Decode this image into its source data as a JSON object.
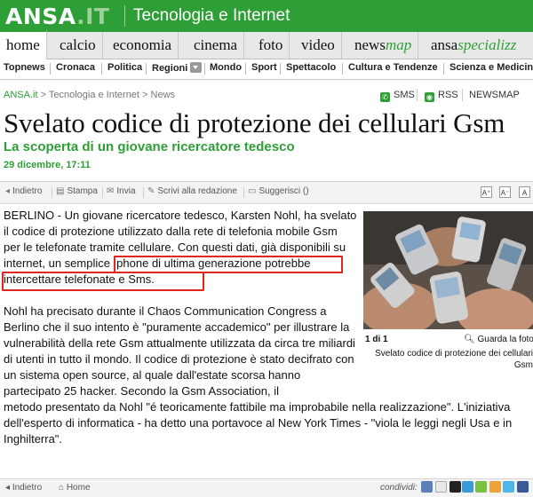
{
  "header": {
    "logo_main": "ANSA",
    "logo_suffix": ".IT",
    "section": "Tecnologia e Internet"
  },
  "main_nav": [
    {
      "label": "home"
    },
    {
      "label": "calcio"
    },
    {
      "label": "economia"
    },
    {
      "label": "cinema"
    },
    {
      "label": "foto"
    },
    {
      "label": "video"
    },
    {
      "label_a": "news",
      "label_b": "map"
    },
    {
      "label_a": "ansa",
      "label_b": "specializz"
    }
  ],
  "sub_nav": [
    "Topnews",
    "Cronaca",
    "Politica",
    "Regioni",
    "Mondo",
    "Sport",
    "Spettacolo",
    "Cultura e Tendenze",
    "Scienza e Medicina"
  ],
  "breadcrumb": {
    "home": "ANSA.it",
    "path": " > Tecnologia e Internet > News"
  },
  "tools": {
    "sms": "SMS",
    "rss": "RSS",
    "newsmap": "NEWSMAP"
  },
  "article": {
    "title": "Svelato codice di protezione dei cellulari Gsm",
    "subtitle": "La scoperta di un giovane ricercatore tedesco",
    "date": "29 dicembre, 17:11",
    "p1_a": "BERLINO - Un giovane ricercatore tedesco, Karsten Nohl, ha svelato il codice di protezione utilizzato dalla rete di telefonia mobile Gsm per le telefonate tramite cellulare. Con questi dati, già disponibili su internet,",
    "p1_b": " un semplice Iphone di ultima generazione potrebbe intercettare telefonate e Sms.",
    "p2": "Nohl ha precisato durante il Chaos Communication Congress a Berlino che il suo intento è \"puramente accademico\" per illustrare la vulnerabilità della rete Gsm attualmente utilizzata da circa tre miliardi di utenti in tutto il mondo. Il codice di protezione è stato decifrato con un sistema open source, al quale dall'estate scorsa hanno partecipato 25 hacker. Secondo la Gsm Association, il",
    "p3": "metodo presentato da Nohl \"é teoricamente fattibile ma improbabile nella realizzazione\". L'iniziativa dell'esperto di informatica - ha detto una portavoce al New York Times - \"viola le leggi negli Usa e in Inghilterra\"."
  },
  "actions": {
    "back": "Indietro",
    "print": "Stampa",
    "send": "Invia",
    "write": "Scrivi alla redazione",
    "suggest": "Suggerisci ()"
  },
  "photo": {
    "counter": "1 di 1",
    "see": "Guarda la foto",
    "caption": "Svelato codice di protezione dei cellulari Gsm"
  },
  "footer": {
    "back": "Indietro",
    "home": "Home",
    "share": "condividi:"
  },
  "colors": {
    "brand_green": "#2e9e36",
    "highlight_red": "#e0261e"
  }
}
